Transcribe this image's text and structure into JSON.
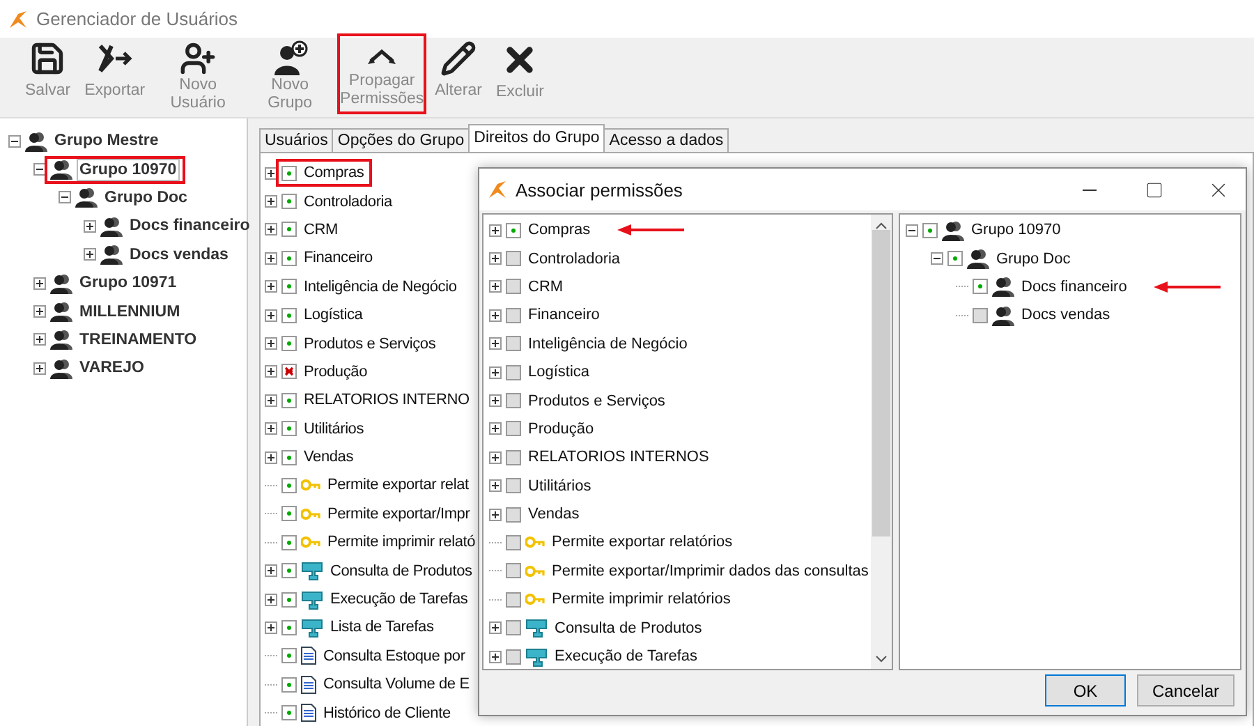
{
  "window": {
    "title": "Gerenciador de Usuários"
  },
  "toolbar": [
    {
      "label": "Salvar",
      "kind": "save",
      "highlighted": false
    },
    {
      "label": "Exportar",
      "kind": "export",
      "highlighted": false
    },
    {
      "label": "Novo Usuário",
      "kind": "new-user",
      "highlighted": false
    },
    {
      "label": "Novo Grupo",
      "kind": "new-group",
      "highlighted": false
    },
    {
      "label": "Propagar Permissões",
      "kind": "propagate",
      "highlighted": true
    },
    {
      "label": "Alterar",
      "kind": "edit",
      "highlighted": false
    },
    {
      "label": "Excluir",
      "kind": "delete",
      "highlighted": false
    }
  ],
  "group_tree": [
    {
      "label": "Grupo Mestre",
      "expanded": true,
      "selected": false,
      "highlighted": false,
      "children": [
        {
          "label": "Grupo 10970",
          "expanded": true,
          "selected": true,
          "highlighted": true,
          "children": [
            {
              "label": "Grupo Doc",
              "expanded": true,
              "selected": false,
              "highlighted": false,
              "children": [
                {
                  "label": "Docs financeiro",
                  "expanded": false,
                  "selected": false,
                  "highlighted": false
                },
                {
                  "label": "Docs vendas",
                  "expanded": false,
                  "selected": false,
                  "highlighted": false
                }
              ]
            }
          ]
        },
        {
          "label": "Grupo 10971",
          "expanded": false,
          "selected": false,
          "highlighted": false
        },
        {
          "label": "MILLENNIUM",
          "expanded": false,
          "selected": false,
          "highlighted": false
        },
        {
          "label": "TREINAMENTO",
          "expanded": false,
          "selected": false,
          "highlighted": false
        },
        {
          "label": "VAREJO",
          "expanded": false,
          "selected": false,
          "highlighted": false
        }
      ]
    }
  ],
  "tabs": [
    {
      "label": "Usuários",
      "selected": false
    },
    {
      "label": "Opções do Grupo",
      "selected": false
    },
    {
      "label": "Direitos do Grupo",
      "selected": true
    },
    {
      "label": "Acesso a dados",
      "selected": false
    }
  ],
  "permissions": [
    {
      "label": "Compras",
      "expandable": true,
      "granted": true,
      "denied": false,
      "kind": "folder",
      "highlighted": true
    },
    {
      "label": "Controladoria",
      "expandable": true,
      "granted": true,
      "denied": false,
      "kind": "folder",
      "highlighted": false
    },
    {
      "label": "CRM",
      "expandable": true,
      "granted": true,
      "denied": false,
      "kind": "folder",
      "highlighted": false
    },
    {
      "label": "Financeiro",
      "expandable": true,
      "granted": true,
      "denied": false,
      "kind": "folder",
      "highlighted": false
    },
    {
      "label": "Inteligência de Negócio",
      "expandable": true,
      "granted": true,
      "denied": false,
      "kind": "folder",
      "highlighted": false
    },
    {
      "label": "Logística",
      "expandable": true,
      "granted": true,
      "denied": false,
      "kind": "folder",
      "highlighted": false
    },
    {
      "label": "Produtos e Serviços",
      "expandable": true,
      "granted": true,
      "denied": false,
      "kind": "folder",
      "highlighted": false
    },
    {
      "label": "Produção",
      "expandable": true,
      "granted": false,
      "denied": true,
      "kind": "folder",
      "highlighted": false
    },
    {
      "label": "RELATORIOS INTERNO",
      "expandable": true,
      "granted": true,
      "denied": false,
      "kind": "folder",
      "highlighted": false
    },
    {
      "label": "Utilitários",
      "expandable": true,
      "granted": true,
      "denied": false,
      "kind": "folder",
      "highlighted": false
    },
    {
      "label": "Vendas",
      "expandable": true,
      "granted": true,
      "denied": false,
      "kind": "folder",
      "highlighted": false
    },
    {
      "label": "Permite exportar relat",
      "expandable": false,
      "granted": true,
      "denied": false,
      "kind": "key",
      "highlighted": false
    },
    {
      "label": "Permite exportar/Impr",
      "expandable": false,
      "granted": true,
      "denied": false,
      "kind": "key",
      "highlighted": false
    },
    {
      "label": "Permite imprimir relató",
      "expandable": false,
      "granted": true,
      "denied": false,
      "kind": "key",
      "highlighted": false
    },
    {
      "label": "Consulta de Produtos",
      "expandable": true,
      "granted": true,
      "denied": false,
      "kind": "module",
      "highlighted": false
    },
    {
      "label": "Execução de Tarefas",
      "expandable": true,
      "granted": true,
      "denied": false,
      "kind": "module",
      "highlighted": false
    },
    {
      "label": "Lista de Tarefas",
      "expandable": true,
      "granted": true,
      "denied": false,
      "kind": "module",
      "highlighted": false
    },
    {
      "label": "Consulta Estoque por",
      "expandable": false,
      "granted": true,
      "denied": false,
      "kind": "report",
      "highlighted": false
    },
    {
      "label": "Consulta Volume de E",
      "expandable": false,
      "granted": true,
      "denied": false,
      "kind": "report",
      "highlighted": false
    },
    {
      "label": "Histórico de Cliente",
      "expandable": false,
      "granted": true,
      "denied": false,
      "kind": "report",
      "highlighted": false
    }
  ],
  "dialog": {
    "title": "Associar permissões",
    "permissions": [
      {
        "label": "Compras",
        "expandable": true,
        "checked": true,
        "kind": "folder",
        "arrow": true
      },
      {
        "label": "Controladoria",
        "expandable": true,
        "checked": false,
        "kind": "folder",
        "arrow": false
      },
      {
        "label": "CRM",
        "expandable": true,
        "checked": false,
        "kind": "folder",
        "arrow": false
      },
      {
        "label": "Financeiro",
        "expandable": true,
        "checked": false,
        "kind": "folder",
        "arrow": false
      },
      {
        "label": "Inteligência de Negócio",
        "expandable": true,
        "checked": false,
        "kind": "folder",
        "arrow": false
      },
      {
        "label": "Logística",
        "expandable": true,
        "checked": false,
        "kind": "folder",
        "arrow": false
      },
      {
        "label": "Produtos e Serviços",
        "expandable": true,
        "checked": false,
        "kind": "folder",
        "arrow": false
      },
      {
        "label": "Produção",
        "expandable": true,
        "checked": false,
        "kind": "folder",
        "arrow": false
      },
      {
        "label": "RELATORIOS INTERNOS",
        "expandable": true,
        "checked": false,
        "kind": "folder",
        "arrow": false
      },
      {
        "label": "Utilitários",
        "expandable": true,
        "checked": false,
        "kind": "folder",
        "arrow": false
      },
      {
        "label": "Vendas",
        "expandable": true,
        "checked": false,
        "kind": "folder",
        "arrow": false
      },
      {
        "label": "Permite exportar relatórios",
        "expandable": false,
        "checked": false,
        "kind": "key",
        "arrow": false
      },
      {
        "label": "Permite exportar/Imprimir dados das consultas",
        "expandable": false,
        "checked": false,
        "kind": "key",
        "arrow": false
      },
      {
        "label": "Permite imprimir relatórios",
        "expandable": false,
        "checked": false,
        "kind": "key",
        "arrow": false
      },
      {
        "label": "Consulta de Produtos",
        "expandable": true,
        "checked": false,
        "kind": "module",
        "arrow": false
      },
      {
        "label": "Execução de Tarefas",
        "expandable": true,
        "checked": false,
        "kind": "module",
        "arrow": false
      }
    ],
    "groups": [
      {
        "label": "Grupo 10970",
        "expanded": true,
        "checked": true,
        "arrow": false,
        "children": [
          {
            "label": "Grupo Doc",
            "expanded": true,
            "checked": true,
            "arrow": false,
            "children": [
              {
                "label": "Docs financeiro",
                "checked": true,
                "arrow": true
              },
              {
                "label": "Docs vendas",
                "checked": false,
                "arrow": false
              }
            ]
          }
        ]
      }
    ],
    "buttons": [
      "OK",
      "Cancelar"
    ]
  }
}
